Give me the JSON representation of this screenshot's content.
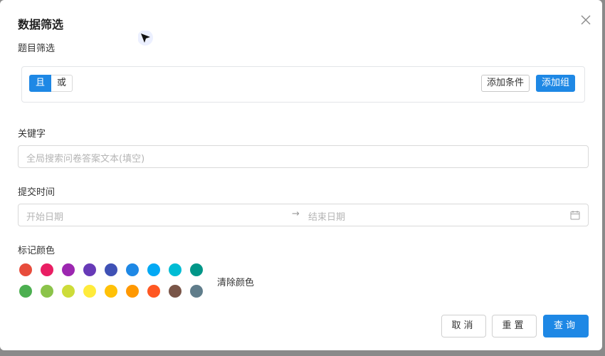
{
  "dialog": {
    "title": "数据筛选",
    "close_icon": "close-icon"
  },
  "question_filter": {
    "label": "题目筛选",
    "logic_and": "且",
    "logic_or": "或",
    "add_condition": "添加条件",
    "add_group": "添加组"
  },
  "keyword": {
    "label": "关键字",
    "placeholder": "全局搜索问卷答案文本(填空)"
  },
  "submit_time": {
    "label": "提交时间",
    "start_placeholder": "开始日期",
    "arrow": "→",
    "end_placeholder": "结束日期",
    "icon": "calendar-icon"
  },
  "mark_color": {
    "label": "标记颜色",
    "row1": [
      "#e74c3c",
      "#e91e63",
      "#9c27b0",
      "#673ab7",
      "#3f51b5",
      "#1e88e5",
      "#03a9f4",
      "#00bcd4",
      "#009688"
    ],
    "row2": [
      "#4caf50",
      "#8bc34a",
      "#cddc39",
      "#ffeb3b",
      "#ffc107",
      "#ff9800",
      "#ff5722",
      "#795548",
      "#607d8b"
    ],
    "clear_label": "清除颜色"
  },
  "footer": {
    "cancel": "取消",
    "reset": "重置",
    "query": "查询"
  },
  "colors": {
    "primary": "#1e88e5"
  }
}
